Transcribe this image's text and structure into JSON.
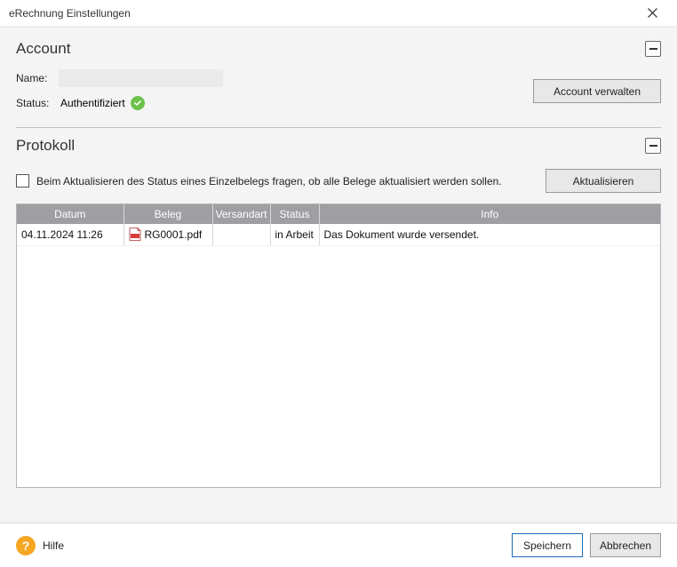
{
  "window": {
    "title": "eRechnung Einstellungen"
  },
  "account": {
    "section_title": "Account",
    "name_label": "Name:",
    "name_value": "",
    "status_label": "Status:",
    "status_value": "Authentifiziert",
    "manage_button": "Account verwalten"
  },
  "protokoll": {
    "section_title": "Protokoll",
    "checkbox_label": "Beim Aktualisieren des Status eines Einzelbelegs fragen, ob alle Belege aktualisiert werden sollen.",
    "checkbox_checked": false,
    "refresh_button": "Aktualisieren",
    "columns": {
      "datum": "Datum",
      "beleg": "Beleg",
      "versandart": "Versandart",
      "status": "Status",
      "info": "Info"
    },
    "rows": [
      {
        "datum": "04.11.2024 11:26",
        "beleg": "RG0001.pdf",
        "versandart": "",
        "status": "in Arbeit",
        "info": "Das Dokument wurde versendet."
      }
    ]
  },
  "footer": {
    "help_label": "Hilfe",
    "save_label": "Speichern",
    "cancel_label": "Abbrechen"
  }
}
